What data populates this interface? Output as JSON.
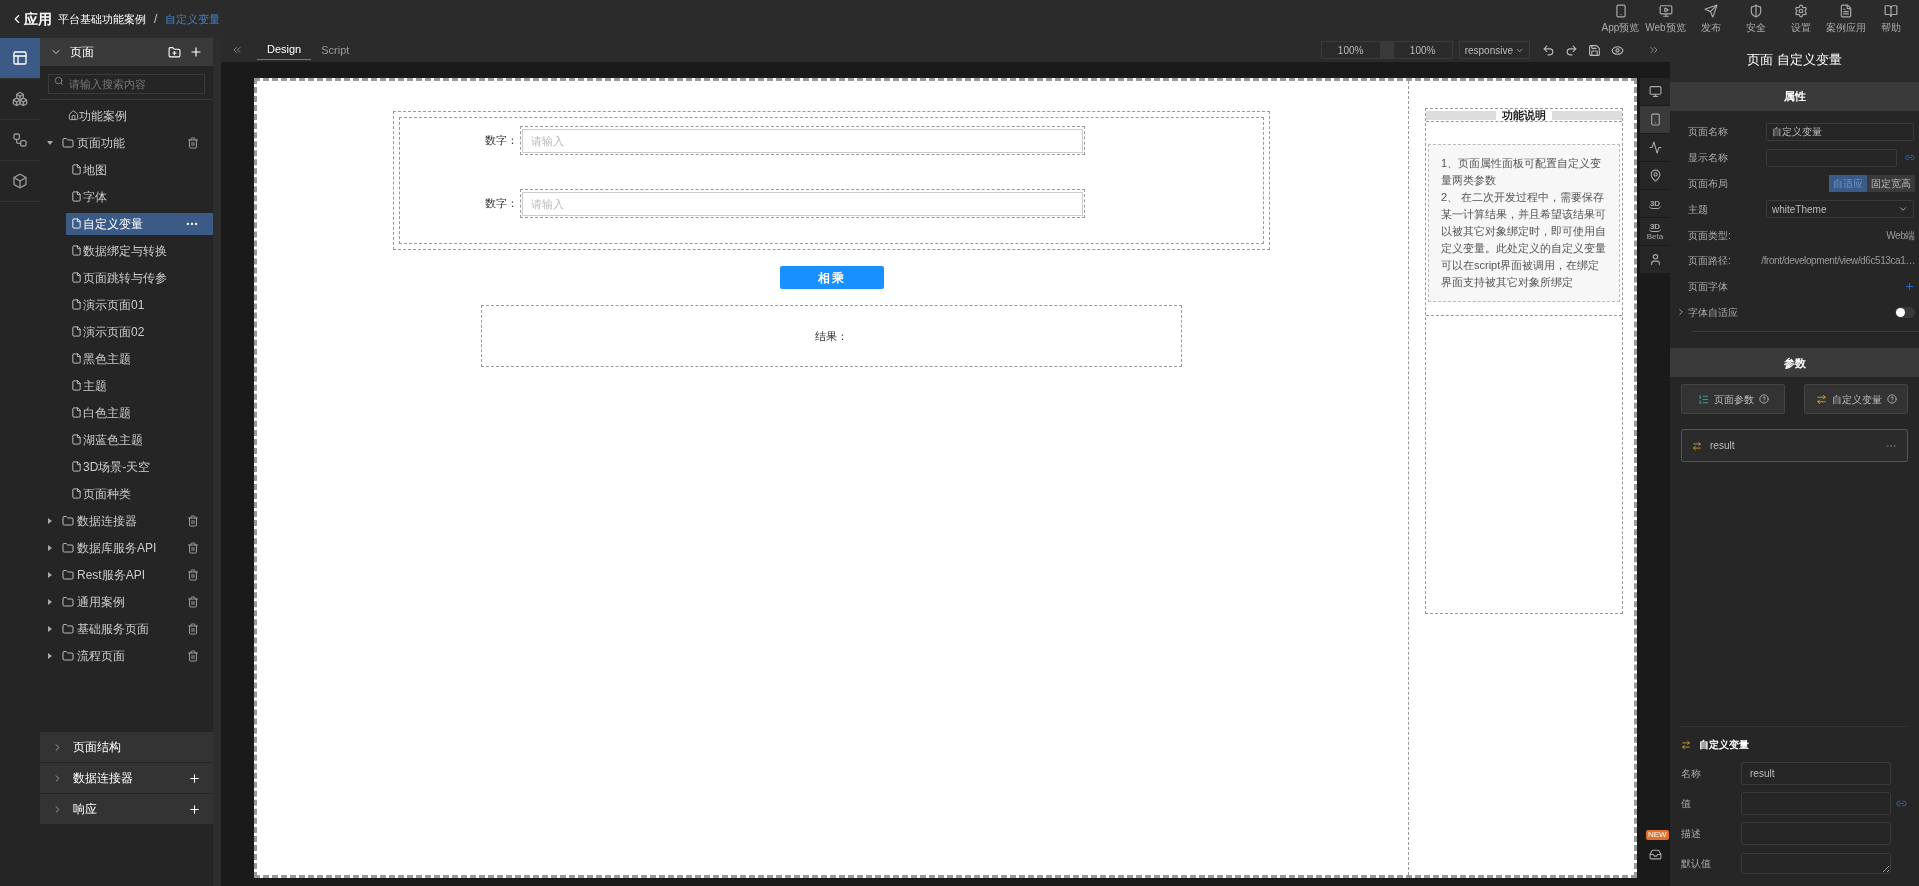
{
  "header": {
    "back": "应用",
    "separator": "/",
    "breadcrumb": [
      {
        "label": "平台基础功能案例",
        "current": false
      },
      {
        "label": "自定义变量",
        "current": true
      }
    ],
    "actions": [
      {
        "label": "App预览",
        "kind": "phone"
      },
      {
        "label": "Web预览",
        "kind": "monitor"
      },
      {
        "label": "发布",
        "kind": "send"
      },
      {
        "label": "安全",
        "kind": "shield"
      },
      {
        "label": "设置",
        "kind": "settings"
      },
      {
        "label": "案例应用",
        "kind": "doc"
      },
      {
        "label": "帮助",
        "kind": "book"
      }
    ]
  },
  "rail": [
    {
      "kind": "layout",
      "selected": true
    },
    {
      "kind": "components",
      "selected": false
    },
    {
      "kind": "flow",
      "selected": false
    },
    {
      "kind": "cube",
      "selected": false
    }
  ],
  "sidebar": {
    "title": "页面",
    "search": {
      "placeholder": "请输入搜索内容"
    },
    "tree": [
      {
        "kind": "home",
        "label": "功能案例"
      },
      {
        "kind": "folder",
        "label": "页面功能",
        "expanded": true,
        "children": [
          {
            "kind": "page",
            "label": "地图",
            "selected": false
          },
          {
            "kind": "page",
            "label": "字体",
            "selected": false
          },
          {
            "kind": "page",
            "label": "自定义变量",
            "selected": true
          },
          {
            "kind": "page",
            "label": "数据绑定与转换",
            "selected": false
          },
          {
            "kind": "page",
            "label": "页面跳转与传参",
            "selected": false
          },
          {
            "kind": "page",
            "label": "演示页面01",
            "selected": false
          },
          {
            "kind": "page",
            "label": "演示页面02",
            "selected": false
          },
          {
            "kind": "page",
            "label": "黑色主题",
            "selected": false
          },
          {
            "kind": "page",
            "label": "主题",
            "selected": false
          },
          {
            "kind": "page",
            "label": "白色主题",
            "selected": false
          },
          {
            "kind": "page",
            "label": "湖蓝色主题",
            "selected": false
          },
          {
            "kind": "page",
            "label": "3D场景-天空",
            "selected": false
          },
          {
            "kind": "page",
            "label": "页面种类",
            "selected": false
          }
        ]
      },
      {
        "kind": "folder",
        "label": "数据连接器",
        "expanded": false
      },
      {
        "kind": "folder",
        "label": "数据库服务API",
        "expanded": false
      },
      {
        "kind": "folder",
        "label": "Rest服务API",
        "expanded": false
      },
      {
        "kind": "folder",
        "label": "通用案例",
        "expanded": false
      },
      {
        "kind": "folder",
        "label": "基础服务页面",
        "expanded": false
      },
      {
        "kind": "folder",
        "label": "流程页面",
        "expanded": false
      }
    ],
    "sections": [
      {
        "label": "页面结构",
        "add": false
      },
      {
        "label": "数据连接器",
        "add": true
      },
      {
        "label": "响应",
        "add": true
      }
    ]
  },
  "toolbar": {
    "tabs": [
      {
        "label": "Design",
        "selected": true
      },
      {
        "label": "Script",
        "selected": false
      }
    ],
    "zoom_a": "100%",
    "zoom_b": "100%",
    "mode": "responsive"
  },
  "canvas": {
    "fields": [
      {
        "label": "数字：",
        "placeholder": "请输入"
      },
      {
        "label": "数字：",
        "placeholder": "请输入"
      }
    ],
    "button": "相乘",
    "result_label": "结果：",
    "note": {
      "title": "功能说明",
      "lines": [
        "1、页面属性面板可配置自定义变量两类参数",
        "2、 在二次开发过程中，需要保存某一计算结果，并且希望该结果可以被其它对象绑定时，即可使用自定义变量。此处定义的自定义变量可以在script界面被调用，在绑定界面支持被其它对象所绑定"
      ]
    }
  },
  "devices": [
    {
      "kind": "monitor",
      "selected": false
    },
    {
      "kind": "phone",
      "selected": true
    },
    {
      "kind": "chart",
      "selected": false
    },
    {
      "kind": "map",
      "selected": false
    },
    {
      "kind": "threed",
      "selected": false,
      "label": "3D"
    },
    {
      "kind": "threed",
      "selected": false,
      "label": "3D",
      "sub": "Beta"
    },
    {
      "kind": "user",
      "selected": false
    }
  ],
  "inbox": {
    "badge": "NEW"
  },
  "panel": {
    "title": "页面 自定义变量",
    "props_header": "属性",
    "props": [
      {
        "kind": "input",
        "label": "页面名称",
        "value": "自定义变量"
      },
      {
        "kind": "input",
        "label": "显示名称",
        "link": true
      },
      {
        "kind": "segmented",
        "label": "页面布局",
        "options": [
          {
            "label": "自适应",
            "selected": true
          },
          {
            "label": "固定宽高",
            "selected": false
          }
        ]
      },
      {
        "kind": "select",
        "label": "主题",
        "value": "whiteTheme"
      },
      {
        "kind": "text",
        "label": "页面类型:",
        "value": "Web端"
      },
      {
        "kind": "text",
        "label": "页面路径:",
        "value": "/front/development/view/d6c513ca1…"
      },
      {
        "kind": "add",
        "label": "页面字体"
      },
      {
        "kind": "toggle",
        "label": "字体自适应",
        "on": false
      }
    ],
    "params_header": "参数",
    "param_buttons": [
      {
        "label": "页面参数",
        "kind": "list"
      },
      {
        "label": "自定义变量",
        "kind": "var"
      }
    ],
    "variables": [
      {
        "name": "result",
        "selected": true
      }
    ],
    "detail": {
      "title": "自定义变量",
      "fields": [
        {
          "kind": "input",
          "label": "名称",
          "value": "result"
        },
        {
          "kind": "input",
          "label": "值",
          "link": true
        },
        {
          "kind": "input",
          "label": "描述"
        },
        {
          "kind": "textarea",
          "label": "默认值"
        }
      ]
    }
  }
}
